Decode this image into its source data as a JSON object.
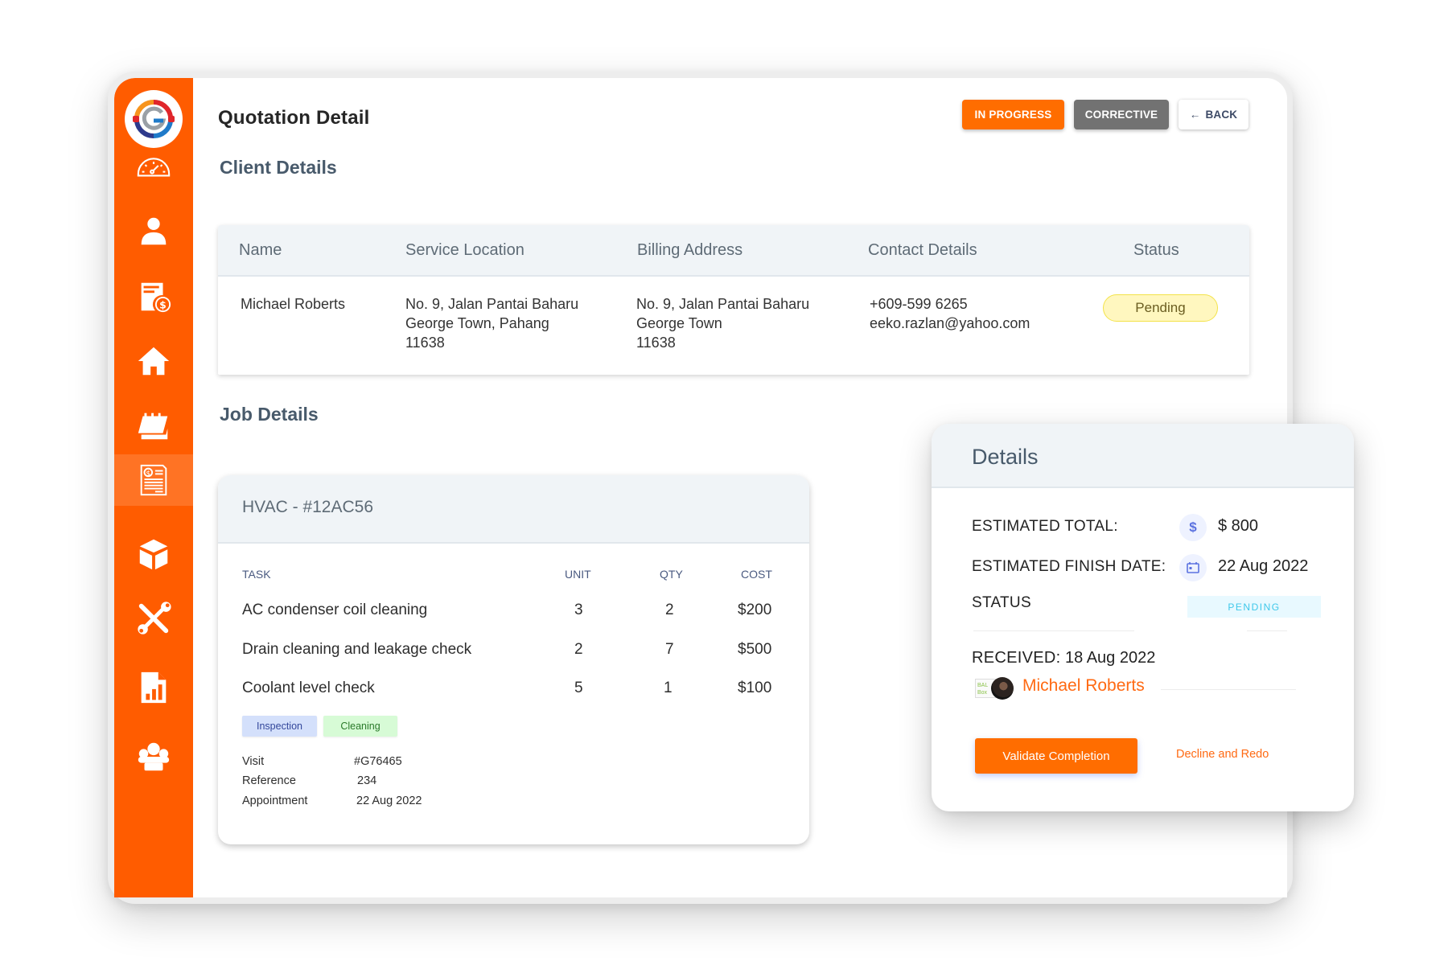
{
  "app": {
    "title": "Quotation Detail",
    "brand_color": "#ff5c00"
  },
  "sidebar": {
    "items": [
      {
        "name": "dashboard",
        "icon": "speedometer-icon"
      },
      {
        "name": "customers",
        "icon": "user-icon"
      },
      {
        "name": "billing",
        "icon": "invoice-dollar-icon"
      },
      {
        "name": "properties",
        "icon": "home-icon"
      },
      {
        "name": "schedule",
        "icon": "calendar-icon"
      },
      {
        "name": "quotations",
        "icon": "quotation-document-icon",
        "active": true
      },
      {
        "name": "inventory",
        "icon": "box-icon"
      },
      {
        "name": "services",
        "icon": "tools-icon"
      },
      {
        "name": "reports",
        "icon": "report-chart-icon"
      },
      {
        "name": "team",
        "icon": "team-icon"
      }
    ]
  },
  "header": {
    "buttons": {
      "in_progress": "IN PROGRESS",
      "corrective": "CORRECTIVE",
      "back": "BACK",
      "back_arrow": "←"
    }
  },
  "client_details": {
    "title": "Client Details",
    "columns": [
      "Name",
      "Service Location",
      "Billing Address",
      "Contact Details",
      "Status"
    ],
    "row": {
      "name": "Michael Roberts",
      "service_location": "No. 9, Jalan Pantai Baharu\nGeorge Town, Pahang\n11638",
      "billing_address": "No. 9, Jalan Pantai Baharu\nGeorge Town\n11638",
      "contact": "+609-599 6265\neeko.razlan@yahoo.com",
      "status": "Pending"
    }
  },
  "job_details": {
    "title": "Job Details",
    "job_title": "HVAC - #12AC56",
    "columns": [
      "TASK",
      "UNIT",
      "QTY",
      "COST"
    ],
    "tasks": [
      {
        "task": "AC condenser coil cleaning",
        "unit": "3",
        "qty": "2",
        "cost": "$200"
      },
      {
        "task": "Drain cleaning and leakage check",
        "unit": "2",
        "qty": "7",
        "cost": "$500"
      },
      {
        "task": "Coolant level check",
        "unit": "5",
        "qty": "1",
        "cost": "$100"
      }
    ],
    "tags": [
      "Inspection",
      "Cleaning"
    ],
    "meta": [
      {
        "label": "Visit",
        "value": "#G76465"
      },
      {
        "label": "Reference",
        "value": "234"
      },
      {
        "label": "Appointment",
        "value": "22 Aug 2022"
      }
    ]
  },
  "details": {
    "title": "Details",
    "estimated_total_label": "ESTIMATED TOTAL:",
    "estimated_total_icon": "$",
    "estimated_total": "$ 800",
    "finish_date_label": "ESTIMATED FINISH DATE:",
    "finish_date": "22 Aug 2022",
    "status_label": "STATUS",
    "status": "PENDING",
    "received_label": "RECEIVED:",
    "received": "18 Aug 2022",
    "assignee": "Michael Roberts",
    "avatar_logo_text": "BAL Box",
    "validate_label": "Validate Completion",
    "decline_label": "Decline and Redo"
  }
}
